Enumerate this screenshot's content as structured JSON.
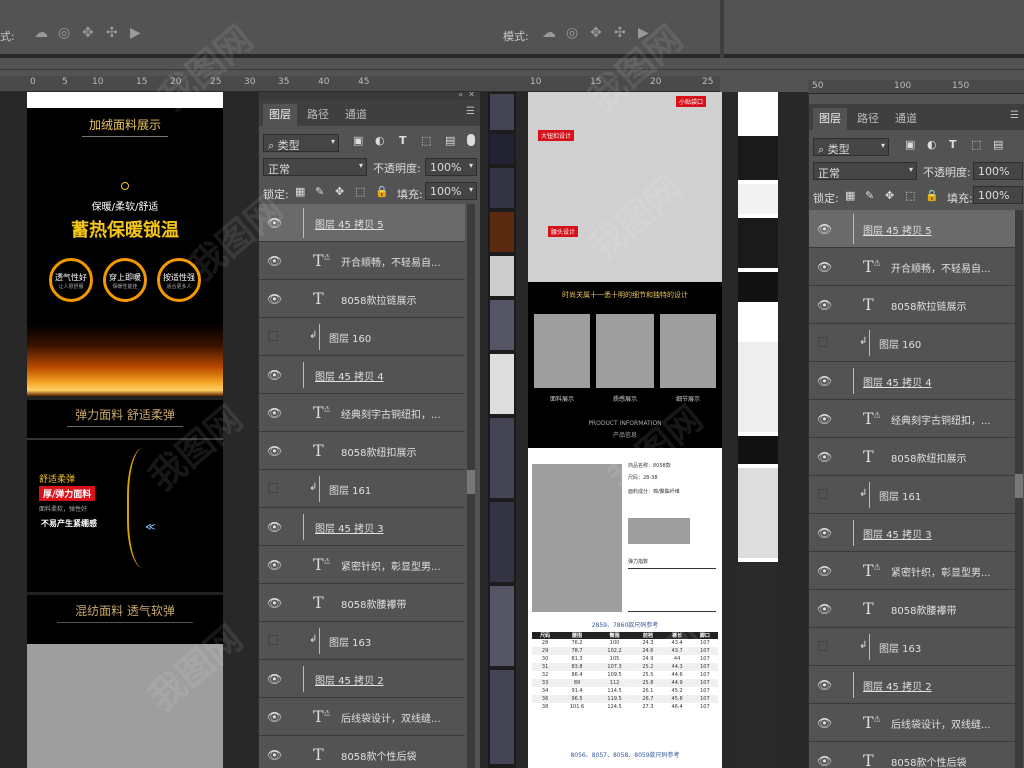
{
  "options_bar": {
    "mode_label_left": "式:",
    "mode_label_mid": "模式:"
  },
  "rulers": {
    "left": [
      "0",
      "5",
      "10",
      "15",
      "20",
      "25",
      "30"
    ],
    "mid": [
      "35",
      "40",
      "45"
    ],
    "center": [
      "10",
      "15",
      "20",
      "25"
    ],
    "right": [
      "50",
      "100",
      "150"
    ]
  },
  "layers_panel": {
    "tabs": [
      "图层",
      "路径",
      "通道"
    ],
    "filter_kind": "类型",
    "blend_mode": "正常",
    "opacity_label": "不透明度:",
    "opacity_value": "100%",
    "lock_label": "锁定:",
    "fill_label": "填充:",
    "fill_value": "100%",
    "layers": [
      {
        "type": "group",
        "name": "图层 45 拷贝 5",
        "selected": true,
        "visible": true
      },
      {
        "type": "text_warn",
        "name": "开合顺畅，不轻易自...",
        "visible": true
      },
      {
        "type": "text",
        "name": "8058款拉链展示",
        "visible": true
      },
      {
        "type": "clip",
        "name": "图层 160",
        "visible": false
      },
      {
        "type": "group",
        "name": "图层 45 拷贝 4",
        "visible": true
      },
      {
        "type": "text_warn",
        "name": "经典刻字古铜纽扣，...",
        "visible": true
      },
      {
        "type": "text",
        "name": "8058款纽扣展示",
        "visible": true
      },
      {
        "type": "clip",
        "name": "图层 161",
        "visible": false
      },
      {
        "type": "group",
        "name": "图层 45 拷贝 3",
        "visible": true
      },
      {
        "type": "text_warn",
        "name": "紧密针织，彰显型男...",
        "visible": true
      },
      {
        "type": "text",
        "name": "8058款腰襻带",
        "visible": true
      },
      {
        "type": "clip",
        "name": "图层 163",
        "visible": false
      },
      {
        "type": "group",
        "name": "图层 45 拷贝 2",
        "visible": true
      },
      {
        "type": "text_warn",
        "name": "后线袋设计，双线缝...",
        "visible": true
      },
      {
        "type": "text",
        "name": "8058款个性后袋",
        "visible": true
      }
    ]
  },
  "left_doc": {
    "title1": "加绒面料展示",
    "subtitle1": "保暖/柔软/舒适",
    "headline1": "蓄热保暖锁温",
    "circles": [
      {
        "main": "透气性好",
        "sub": "让人很舒服"
      },
      {
        "main": "穿上即暖",
        "sub": "保暖性能佳"
      },
      {
        "main": "按适性强",
        "sub": "适合更多人"
      }
    ],
    "title2": "弹力面料 舒适柔弹",
    "side_label1": "舒适柔弹",
    "side_red": "厚/弹力面料",
    "side_text": "面料柔软，弹性好",
    "side_bold": "不易产生紧绷感",
    "title3": "混纺面料 透气软弹"
  },
  "center_doc": {
    "tags": [
      "大钮扣设计",
      "小贴袋口",
      "腰头设计"
    ],
    "dark_title": "时尚关属十一悉十明的细节和独特的设计",
    "cap1": "面料展示",
    "cap2": "质感展示",
    "cap3": "细节展示",
    "info_heading": "PRODUCT INFORMATION",
    "info_cn": "产品信息",
    "info_lines": [
      "商品名称：8058款",
      "尺码：28-38",
      "面料成分：棉/聚酯纤维",
      "弹力指数"
    ],
    "size_title": "2859、7860款尺码参考",
    "size_header": [
      "尺码",
      "腰围",
      "臀围",
      "前裆",
      "裤长",
      "脚口"
    ],
    "size_rows": [
      [
        "28",
        "76.2",
        "100",
        "24.3",
        "43.4",
        "107"
      ],
      [
        "29",
        "78.7",
        "102.2",
        "24.6",
        "43.7",
        "107"
      ],
      [
        "30",
        "81.3",
        "105",
        "24.9",
        "44",
        "107"
      ],
      [
        "31",
        "83.8",
        "107.3",
        "25.2",
        "44.3",
        "107"
      ],
      [
        "32",
        "86.4",
        "109.5",
        "25.5",
        "44.6",
        "107"
      ],
      [
        "33",
        "89",
        "112",
        "25.8",
        "44.9",
        "107"
      ],
      [
        "34",
        "91.4",
        "114.5",
        "26.1",
        "45.2",
        "107"
      ],
      [
        "36",
        "96.5",
        "119.5",
        "26.7",
        "45.8",
        "107"
      ],
      [
        "38",
        "101.6",
        "124.5",
        "27.3",
        "46.4",
        "107"
      ]
    ],
    "bottom_title": "8056、8057、8058、8059款尺码参考"
  },
  "watermark": "我图网",
  "colors": {
    "accent_yellow": "#f5c518",
    "accent_red": "#d8101a",
    "panel_bg": "#535353",
    "canvas_bg": "#282828"
  }
}
